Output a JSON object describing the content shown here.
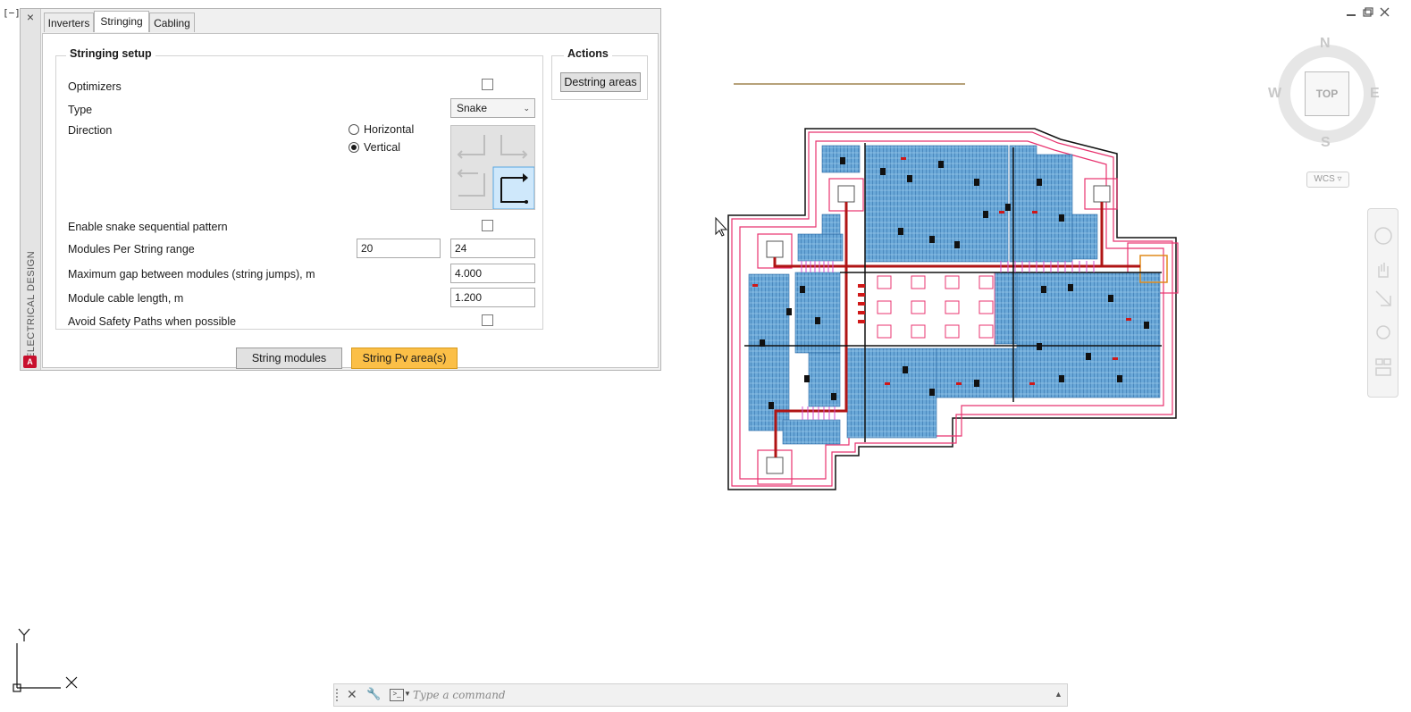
{
  "viewport": {
    "label": "[−]["
  },
  "palette": {
    "title": "ELECTRICAL DESIGN",
    "logo": "A",
    "close_glyph": "×",
    "tabs": [
      {
        "label": "Inverters",
        "active": false
      },
      {
        "label": "Stringing",
        "active": true
      },
      {
        "label": "Cabling",
        "active": false
      }
    ],
    "setup": {
      "title": "Stringing setup",
      "optimizers_label": "Optimizers",
      "optimizers_checked": false,
      "type_label": "Type",
      "type_value": "Snake",
      "direction_label": "Direction",
      "direction_options": [
        "Horizontal",
        "Vertical"
      ],
      "direction_selected": "Vertical",
      "snake_label": "Enable snake sequential pattern",
      "snake_checked": false,
      "mps_label": "Modules Per String range",
      "mps_min": "20",
      "mps_max": "24",
      "gap_label": "Maximum gap between modules (string jumps), m",
      "gap_value": "4.000",
      "cable_label": "Module cable length, m",
      "cable_value": "1.200",
      "avoid_label": "Avoid Safety Paths when possible",
      "avoid_checked": false
    },
    "actions": {
      "title": "Actions",
      "destring_label": "Destring areas"
    },
    "buttons": {
      "string_modules": "String modules",
      "string_pv": "String Pv area(s)"
    }
  },
  "viewcube": {
    "north": "N",
    "south": "S",
    "east": "E",
    "west": "W",
    "top": "TOP",
    "wcs": "WCS"
  },
  "ucs": {
    "x": "X",
    "y": "Y"
  },
  "command": {
    "placeholder": "Type a command"
  },
  "colors": {
    "primary_button": "#fbbf47",
    "boundary": "#e8336f",
    "panel_fill": "#4a90c8",
    "cable_red": "#b01515"
  }
}
